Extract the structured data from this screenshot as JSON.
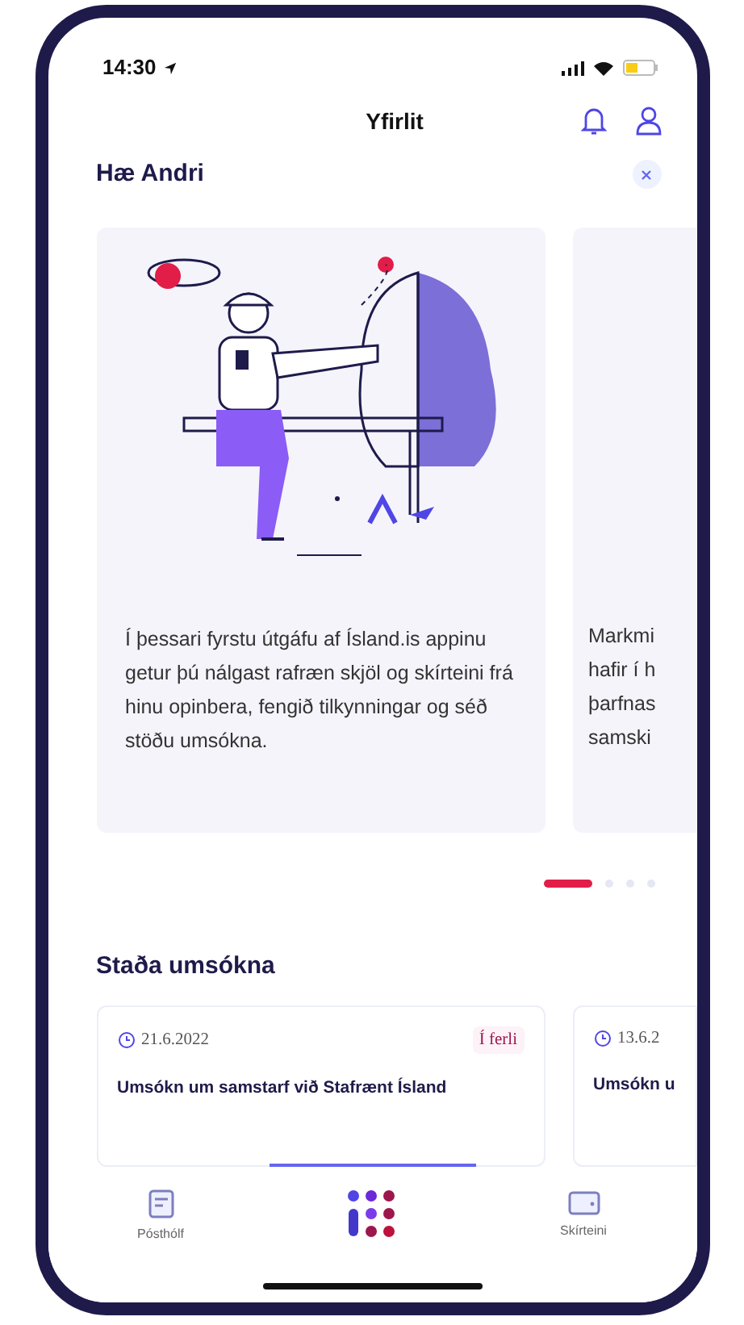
{
  "status_bar": {
    "time": "14:30"
  },
  "header": {
    "title": "Yfirlit"
  },
  "greeting": {
    "title": "Hæ Andri"
  },
  "onboarding_cards": [
    {
      "kind": "illustrated",
      "lines": [
        "Í þessari fyrstu útgáfu af Ísland.is appinu getur þú nálgast rafræn skjöl og skírteini frá hinu opinbera, fengið tilkynningar og séð stöðu umsókna."
      ]
    },
    {
      "kind": "partial",
      "lines": [
        "Markmi",
        "hafir í h",
        "þarfnas",
        "samski"
      ]
    }
  ],
  "carousel_dots": [
    {
      "selected": true
    },
    {
      "selected": false
    },
    {
      "selected": false
    },
    {
      "selected": false
    }
  ],
  "applications": {
    "title": "Staða umsókna",
    "cards": [
      {
        "date": "21.6.2022",
        "badge": "Í ferli",
        "title": "Umsókn um samstarf við Stafrænt Ísland"
      },
      {
        "date": "13.6.2",
        "title": "Umsókn u"
      }
    ]
  },
  "tab_bar": [
    {
      "kind": "inbox",
      "label": "Pósthólf",
      "selected": false
    },
    {
      "kind": "home",
      "selected": true
    },
    {
      "kind": "wallet",
      "label": "Skírteini",
      "selected": false
    }
  ]
}
